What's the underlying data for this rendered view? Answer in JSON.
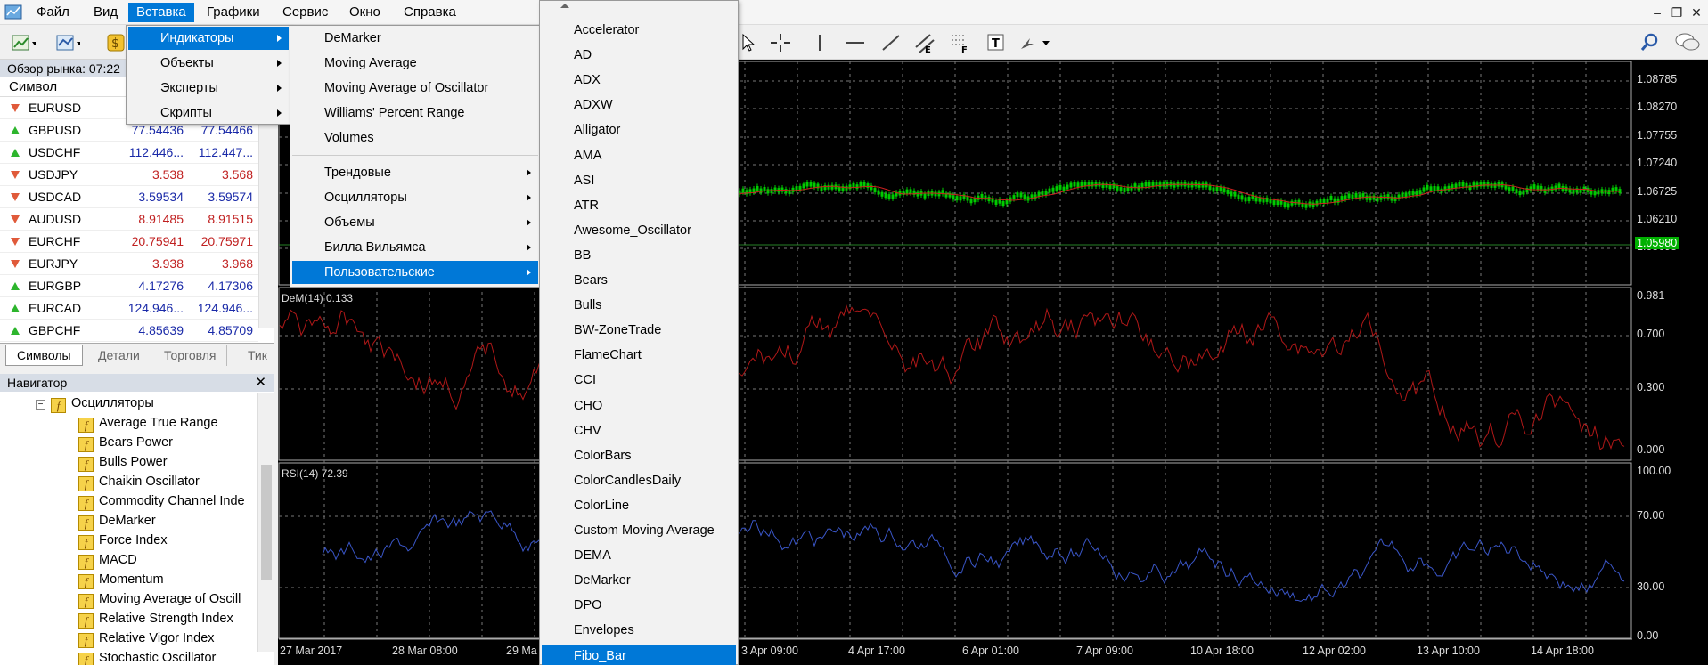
{
  "menubar": {
    "items": [
      "Файл",
      "Вид",
      "Вставка",
      "Графики",
      "Сервис",
      "Окно",
      "Справка"
    ],
    "active_index": 2,
    "icons": [
      "app-icon",
      "minimize-icon",
      "restore-icon",
      "close-icon"
    ]
  },
  "toolbar": {
    "icons": [
      "new-chart-icon",
      "profiles-icon",
      "market-watch-icon",
      "cursor-icon",
      "crosshair-icon",
      "vertical-line-icon",
      "horizontal-line-icon",
      "trendline-icon",
      "channel-icon",
      "fibonacci-icon",
      "text-icon",
      "arrows-icon",
      "search-icon",
      "chat-icon"
    ]
  },
  "market_watch": {
    "title": "Обзор рынка: 07:22",
    "column_symbol": "Символ",
    "rows": [
      {
        "symbol": "EURUSD",
        "bid": "",
        "ask": "",
        "dir": "down",
        "color": "blue"
      },
      {
        "symbol": "GBPUSD",
        "bid": "77.54436",
        "ask": "77.54466",
        "dir": "up",
        "color": "blue"
      },
      {
        "symbol": "USDCHF",
        "bid": "112.446...",
        "ask": "112.447...",
        "dir": "up",
        "color": "blue"
      },
      {
        "symbol": "USDJPY",
        "bid": "3.538",
        "ask": "3.568",
        "dir": "down",
        "color": "red"
      },
      {
        "symbol": "USDCAD",
        "bid": "3.59534",
        "ask": "3.59574",
        "dir": "down",
        "color": "blue"
      },
      {
        "symbol": "AUDUSD",
        "bid": "8.91485",
        "ask": "8.91515",
        "dir": "down",
        "color": "red"
      },
      {
        "symbol": "EURCHF",
        "bid": "20.75941",
        "ask": "20.75971",
        "dir": "down",
        "color": "red"
      },
      {
        "symbol": "EURJPY",
        "bid": "3.938",
        "ask": "3.968",
        "dir": "down",
        "color": "red"
      },
      {
        "symbol": "EURGBP",
        "bid": "4.17276",
        "ask": "4.17306",
        "dir": "up",
        "color": "blue"
      },
      {
        "symbol": "EURCAD",
        "bid": "124.946...",
        "ask": "124.946...",
        "dir": "up",
        "color": "blue"
      },
      {
        "symbol": "GBPCHF",
        "bid": "4.85639",
        "ask": "4.85709",
        "dir": "up",
        "color": "blue"
      }
    ],
    "tabs": [
      "Символы",
      "Детали",
      "Торговля",
      "Тик"
    ]
  },
  "navigator": {
    "title": "Навигатор",
    "close": "✕",
    "folder": "Осцилляторы",
    "items": [
      "Average True Range",
      "Bears Power",
      "Bulls Power",
      "Chaikin Oscillator",
      "Commodity Channel Inde",
      "DeMarker",
      "Force Index",
      "MACD",
      "Momentum",
      "Moving Average of Oscill",
      "Relative Strength Index",
      "Relative Vigor Index",
      "Stochastic Oscillator"
    ]
  },
  "menu_insert": {
    "items": [
      {
        "label": "Индикаторы",
        "submenu": true
      },
      {
        "label": "Объекты",
        "submenu": true
      },
      {
        "label": "Эксперты",
        "submenu": true
      },
      {
        "label": "Скрипты",
        "submenu": true
      }
    ],
    "highlighted_index": 0
  },
  "menu_indicators": {
    "top_items": [
      "DeMarker",
      "Moving Average",
      "Moving Average of Oscillator",
      "Williams' Percent Range",
      "Volumes"
    ],
    "group_items": [
      {
        "label": "Трендовые",
        "submenu": true
      },
      {
        "label": "Осцилляторы",
        "submenu": true
      },
      {
        "label": "Объемы",
        "submenu": true
      },
      {
        "label": "Билла Вильямса",
        "submenu": true
      },
      {
        "label": "Пользовательские",
        "submenu": true
      }
    ],
    "highlighted_group_index": 4
  },
  "menu_custom": {
    "items": [
      "Accelerator",
      "AD",
      "ADX",
      "ADXW",
      "Alligator",
      "AMA",
      "ASI",
      "ATR",
      "Awesome_Oscillator",
      "BB",
      "Bears",
      "Bulls",
      "BW-ZoneTrade",
      "FlameChart",
      "CCI",
      "CHO",
      "CHV",
      "ColorBars",
      "ColorCandlesDaily",
      "ColorLine",
      "Custom Moving Average",
      "DEMA",
      "DeMarker",
      "DPO",
      "Envelopes",
      "Fibo_Bar"
    ],
    "highlighted_index": 25
  },
  "chart": {
    "main_prices": [
      "1.08785",
      "1.08270",
      "1.07755",
      "1.07240",
      "1.06725",
      "1.06210",
      "1.05695"
    ],
    "current_price": "1.05980",
    "dem_label": "DeM(14) 0.133",
    "dem_levels": [
      "0.981",
      "0.700",
      "0.300",
      "0.000"
    ],
    "rsi_label": "RSI(14) 72.39",
    "rsi_levels": [
      "100.00",
      "70.00",
      "30.00",
      "0.00"
    ],
    "times": [
      "27 Mar 2017",
      "28 Mar 08:00",
      "29 Ma",
      "3 Apr 09:00",
      "4 Apr 17:00",
      "6 Apr 01:00",
      "7 Apr 09:00",
      "10 Apr 18:00",
      "12 Apr 02:00",
      "13 Apr 10:00",
      "14 Apr 18:00"
    ],
    "colors": {
      "candle": "#00cc00",
      "ma": "#cc2020",
      "dem": "#b01818",
      "rsi": "#3a56c8",
      "grid": "#777777",
      "current_price_bg": "#00b000"
    }
  }
}
